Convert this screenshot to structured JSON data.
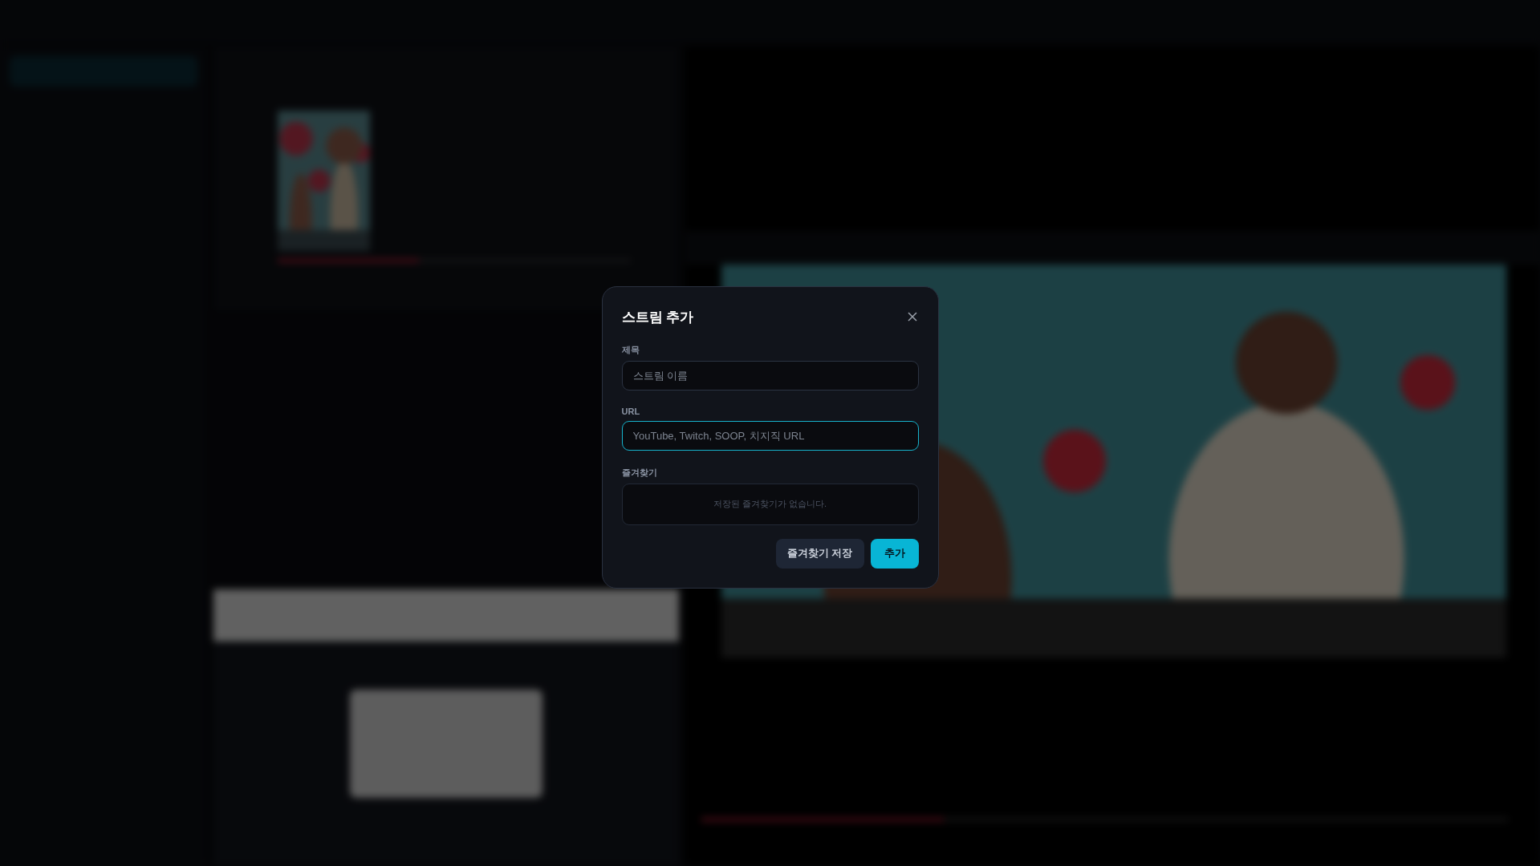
{
  "dialog": {
    "title": "스트림 추가",
    "fields": [
      {
        "label": "제목",
        "placeholder": "스트림 이름",
        "focused": false
      },
      {
        "label": "URL",
        "placeholder": "YouTube, Twitch, SOOP, 치지직 URL",
        "focused": true
      }
    ],
    "favorites": {
      "label": "즐겨찾기",
      "empty_text": "저장된 즐겨찾기가 없습니다."
    },
    "buttons": [
      {
        "label": "즐겨찾기 저장",
        "kind": "secondary"
      },
      {
        "label": "추가",
        "kind": "primary"
      }
    ]
  }
}
